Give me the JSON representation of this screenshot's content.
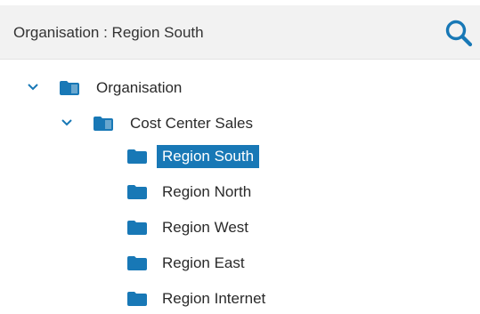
{
  "header": {
    "title": "Organisation : Region South",
    "search_icon": "search-icon"
  },
  "colors": {
    "header_bg": "#f2f2f2",
    "accent": "#1878b6",
    "folder": "#1878b6",
    "selected_text": "#ffffff"
  },
  "tree": {
    "root": {
      "label": "Organisation",
      "expanded": true,
      "icon": "folder-shared-icon"
    },
    "cost_center": {
      "label": "Cost Center Sales",
      "expanded": true,
      "icon": "folder-shared-icon"
    },
    "regions": [
      {
        "label": "Region South",
        "selected": true,
        "icon": "folder-icon"
      },
      {
        "label": "Region North",
        "selected": false,
        "icon": "folder-icon"
      },
      {
        "label": "Region West",
        "selected": false,
        "icon": "folder-icon"
      },
      {
        "label": "Region East",
        "selected": false,
        "icon": "folder-icon"
      },
      {
        "label": "Region Internet",
        "selected": false,
        "icon": "folder-icon"
      }
    ]
  }
}
